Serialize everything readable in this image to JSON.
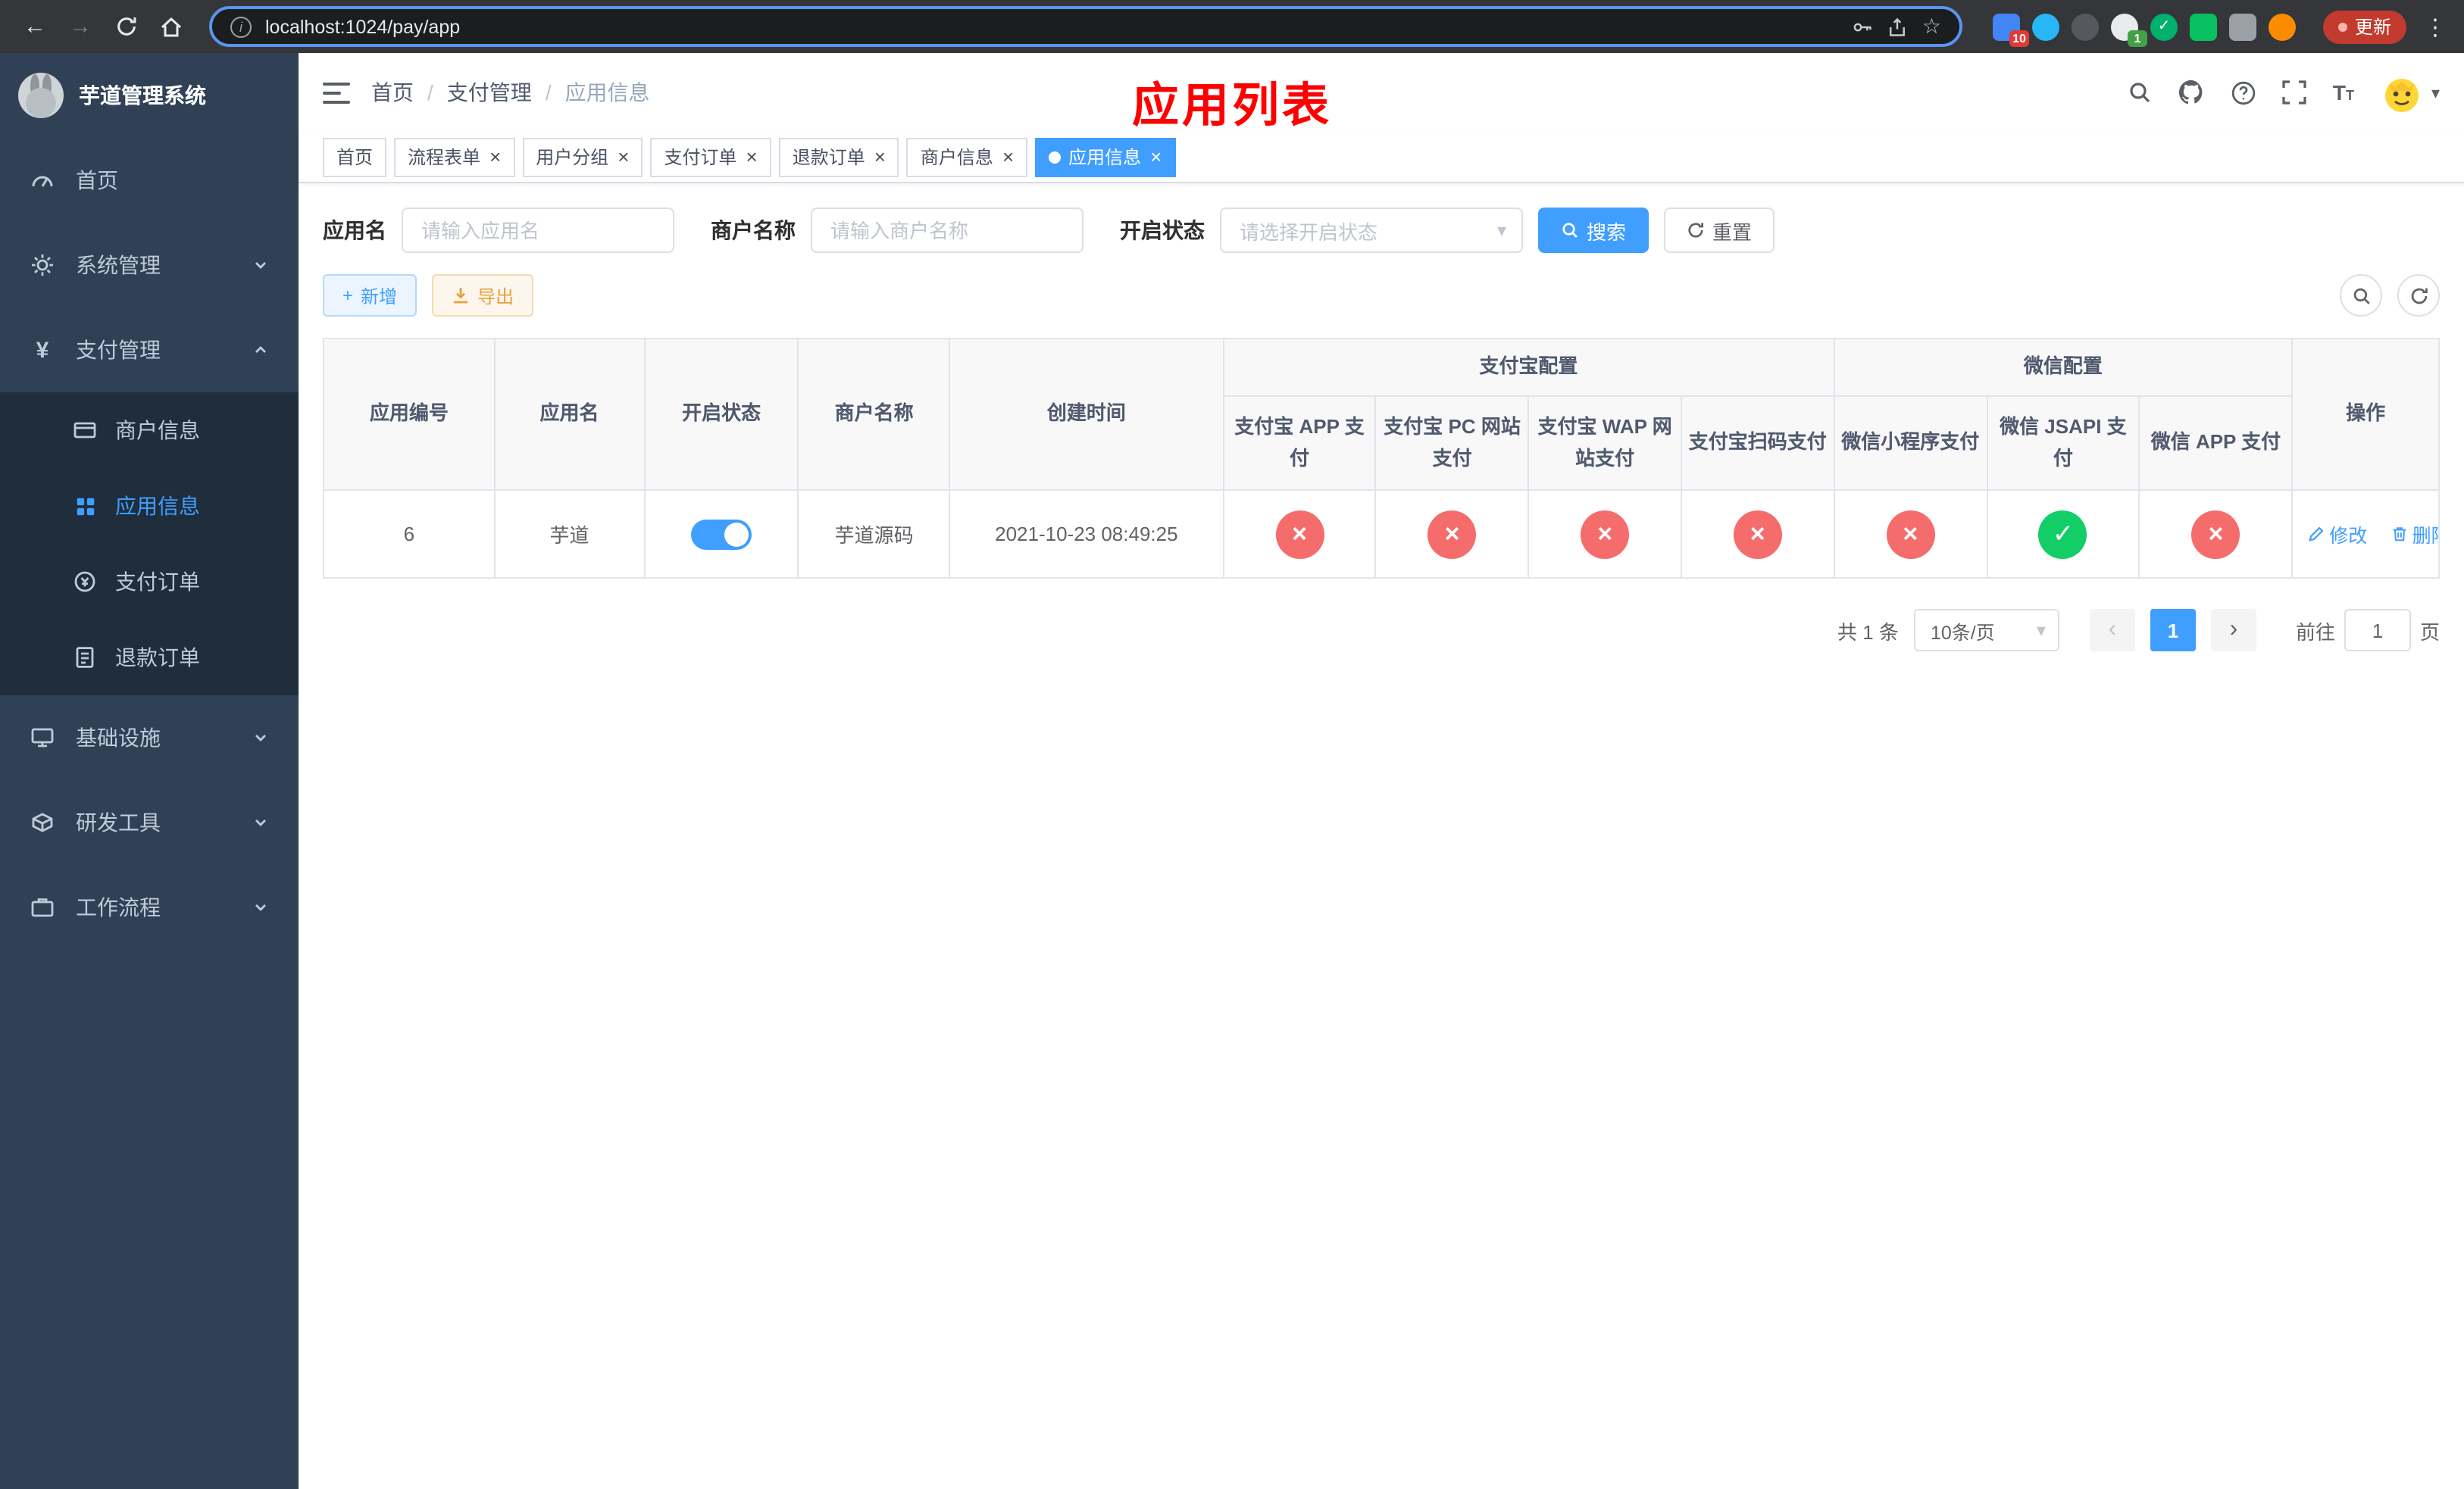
{
  "browser": {
    "url": "localhost:1024/pay/app",
    "update_label": "更新",
    "ext_badges": {
      "first": "10",
      "second": "1"
    }
  },
  "sidebar": {
    "title": "芋道管理系统",
    "items": [
      {
        "label": "首页"
      },
      {
        "label": "系统管理"
      },
      {
        "label": "支付管理"
      },
      {
        "label": "基础设施"
      },
      {
        "label": "研发工具"
      },
      {
        "label": "工作流程"
      }
    ],
    "payment_submenu": [
      {
        "label": "商户信息"
      },
      {
        "label": "应用信息"
      },
      {
        "label": "支付订单"
      },
      {
        "label": "退款订单"
      }
    ]
  },
  "navbar": {
    "breadcrumb": [
      "首页",
      "支付管理",
      "应用信息"
    ],
    "overlay_title": "应用列表"
  },
  "tabs": [
    {
      "label": "首页",
      "closable": false
    },
    {
      "label": "流程表单",
      "closable": true
    },
    {
      "label": "用户分组",
      "closable": true
    },
    {
      "label": "支付订单",
      "closable": true
    },
    {
      "label": "退款订单",
      "closable": true
    },
    {
      "label": "商户信息",
      "closable": true
    },
    {
      "label": "应用信息",
      "closable": true,
      "active": true
    }
  ],
  "filters": {
    "app_name_label": "应用名",
    "app_name_placeholder": "请输入应用名",
    "merchant_label": "商户名称",
    "merchant_placeholder": "请输入商户名称",
    "status_label": "开启状态",
    "status_placeholder": "请选择开启状态",
    "search_label": "搜索",
    "reset_label": "重置"
  },
  "toolbar": {
    "add_label": "新增",
    "export_label": "导出"
  },
  "table": {
    "headers": {
      "app_id": "应用编号",
      "app_name": "应用名",
      "status": "开启状态",
      "merchant": "商户名称",
      "created": "创建时间",
      "alipay_group": "支付宝配置",
      "wechat_group": "微信配置",
      "ops": "操作",
      "sub": [
        "支付宝 APP 支付",
        "支付宝 PC 网站支付",
        "支付宝 WAP 网站支付",
        "支付宝扫码支付",
        "微信小程序支付",
        "微信 JSAPI 支付",
        "微信 APP 支付"
      ]
    },
    "row": {
      "id": "6",
      "name": "芋道",
      "status_on": true,
      "merchant": "芋道源码",
      "created": "2021-10-23 08:49:25",
      "flags": [
        false,
        false,
        false,
        false,
        false,
        true,
        false
      ],
      "edit_label": "修改",
      "delete_label": "删除"
    }
  },
  "pagination": {
    "total": "共 1 条",
    "page_size": "10条/页",
    "current_page": "1",
    "goto_prefix": "前往",
    "goto_value": "1",
    "goto_suffix": "页"
  },
  "icons": {
    "back": "←",
    "forward": "→",
    "star": "☆",
    "menu_dots": "⋮",
    "caret": "▾",
    "plus": "+",
    "info": "i",
    "close": "×",
    "breadcrumb_sep": "/",
    "prev": "‹",
    "next": "›",
    "check": "✓",
    "cross": "×"
  },
  "colors": {
    "primary": "#409eff",
    "danger": "#f56c6c",
    "success": "#13ce66",
    "warning": "#e6a23c",
    "sidebar_bg": "#304156",
    "submenu_bg": "#1f2d3d",
    "overlay_title_red": "#ff0000"
  }
}
